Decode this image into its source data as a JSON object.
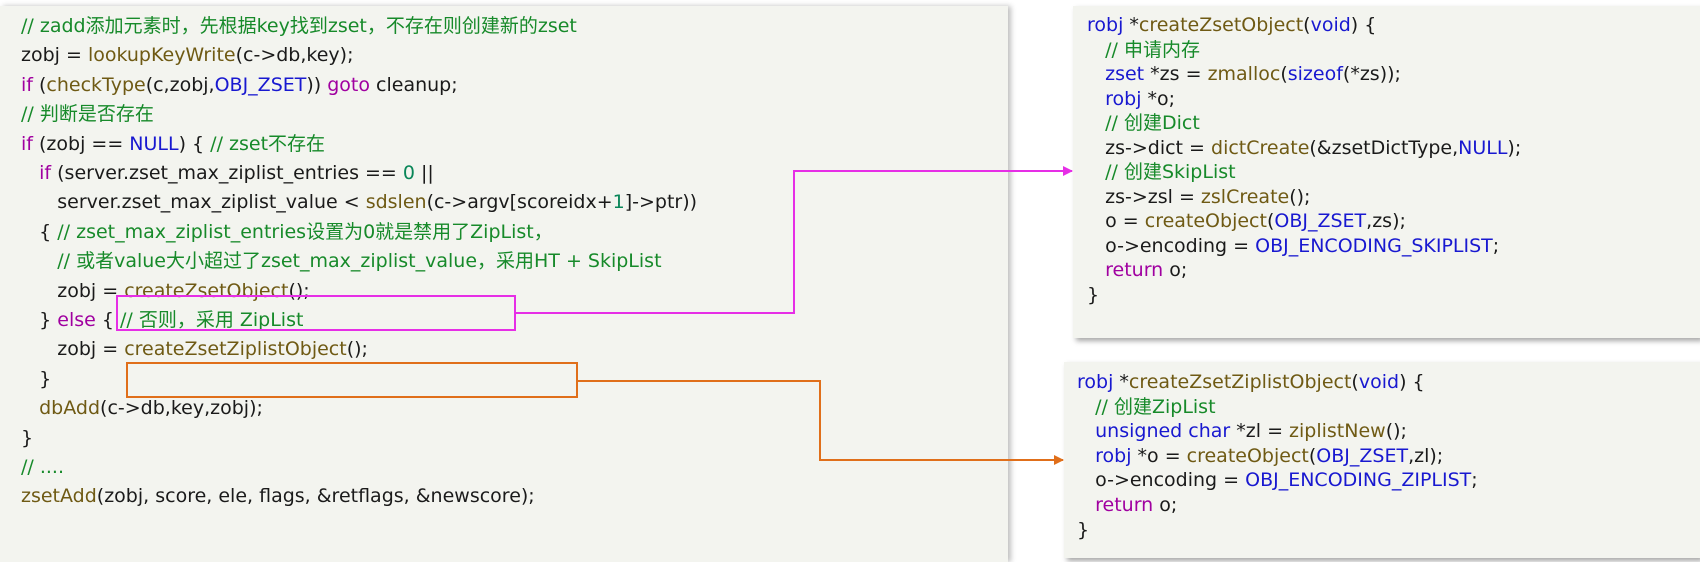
{
  "colors": {
    "keyword": "#a000a0",
    "function": "#6f5a14",
    "constant": "#1818d0",
    "comment": "#178a2a",
    "number": "#098658",
    "plain": "#1a1a1a",
    "highlight_magenta": "#e62ee6",
    "highlight_orange": "#e06f1a",
    "panel_background": "#f3f4ef"
  },
  "main_code": [
    [
      [
        "cm",
        "// zadd添加元素时，先根据key找到zset，不存在则创建新的zset"
      ]
    ],
    [
      [
        "p",
        "zobj = "
      ],
      [
        "fn",
        "lookupKeyWrite"
      ],
      [
        "p",
        "(c->db,key);"
      ]
    ],
    [
      [
        "kw",
        "if"
      ],
      [
        "p",
        " ("
      ],
      [
        "fn",
        "checkType"
      ],
      [
        "p",
        "(c,zobj,"
      ],
      [
        "const",
        "OBJ_ZSET"
      ],
      [
        "p",
        ")) "
      ],
      [
        "kw",
        "goto"
      ],
      [
        "p",
        " cleanup;"
      ]
    ],
    [
      [
        "cm",
        "// 判断是否存在"
      ]
    ],
    [
      [
        "kw",
        "if"
      ],
      [
        "p",
        " (zobj == "
      ],
      [
        "const",
        "NULL"
      ],
      [
        "p",
        ") { "
      ],
      [
        "cm",
        "// zset不存在"
      ]
    ],
    [
      [
        "p",
        "   "
      ],
      [
        "kw",
        "if"
      ],
      [
        "p",
        " (server.zset_max_ziplist_entries == "
      ],
      [
        "num",
        "0"
      ],
      [
        "p",
        " ||"
      ]
    ],
    [
      [
        "p",
        "      server.zset_max_ziplist_value < "
      ],
      [
        "fn",
        "sdslen"
      ],
      [
        "p",
        "(c->argv[scoreidx+"
      ],
      [
        "num",
        "1"
      ],
      [
        "p",
        "]->ptr))"
      ]
    ],
    [
      [
        "p",
        "   { "
      ],
      [
        "cm",
        "// zset_max_ziplist_entries设置为0就是禁用了ZipList，"
      ]
    ],
    [
      [
        "p",
        "      "
      ],
      [
        "cm",
        "// 或者value大小超过了zset_max_ziplist_value，采用HT + SkipList"
      ]
    ],
    [
      [
        "p",
        "      zobj = "
      ],
      [
        "fn",
        "createZsetObject"
      ],
      [
        "p",
        "();"
      ]
    ],
    [
      [
        "p",
        "   } "
      ],
      [
        "kw",
        "else"
      ],
      [
        "p",
        " { "
      ],
      [
        "cm",
        "// 否则，采用 ZipList"
      ]
    ],
    [
      [
        "p",
        "      zobj = "
      ],
      [
        "fn",
        "createZsetZiplistObject"
      ],
      [
        "p",
        "();"
      ]
    ],
    [
      [
        "p",
        "   }"
      ]
    ],
    [
      [
        "p",
        "   "
      ],
      [
        "fn",
        "dbAdd"
      ],
      [
        "p",
        "(c->db,key,zobj);"
      ]
    ],
    [
      [
        "p",
        "}"
      ]
    ],
    [
      [
        "cm",
        "// ...."
      ]
    ],
    [
      [
        "fn",
        "zsetAdd"
      ],
      [
        "p",
        "(zobj, score, ele, flags, &retflags, &newscore);"
      ]
    ]
  ],
  "zset_code": [
    [
      [
        "const",
        "robj"
      ],
      [
        "p",
        " *"
      ],
      [
        "fn",
        "createZsetObject"
      ],
      [
        "p",
        "("
      ],
      [
        "const",
        "void"
      ],
      [
        "p",
        ") {"
      ]
    ],
    [
      [
        "p",
        "   "
      ],
      [
        "cm",
        "// 申请内存"
      ]
    ],
    [
      [
        "p",
        "   "
      ],
      [
        "const",
        "zset"
      ],
      [
        "p",
        " *zs = "
      ],
      [
        "fn",
        "zmalloc"
      ],
      [
        "p",
        "("
      ],
      [
        "const",
        "sizeof"
      ],
      [
        "p",
        "(*zs));"
      ]
    ],
    [
      [
        "p",
        "   "
      ],
      [
        "const",
        "robj"
      ],
      [
        "p",
        " *o;"
      ]
    ],
    [
      [
        "p",
        "   "
      ],
      [
        "cm",
        "// 创建Dict"
      ]
    ],
    [
      [
        "p",
        "   zs->dict = "
      ],
      [
        "fn",
        "dictCreate"
      ],
      [
        "p",
        "(&zsetDictType,"
      ],
      [
        "const",
        "NULL"
      ],
      [
        "p",
        ");"
      ]
    ],
    [
      [
        "p",
        "   "
      ],
      [
        "cm",
        "// 创建SkipList"
      ]
    ],
    [
      [
        "p",
        "   zs->zsl = "
      ],
      [
        "fn",
        "zslCreate"
      ],
      [
        "p",
        "();"
      ]
    ],
    [
      [
        "p",
        "   o = "
      ],
      [
        "fn",
        "createObject"
      ],
      [
        "p",
        "("
      ],
      [
        "const",
        "OBJ_ZSET"
      ],
      [
        "p",
        ",zs);"
      ]
    ],
    [
      [
        "p",
        "   o->encoding = "
      ],
      [
        "const",
        "OBJ_ENCODING_SKIPLIST"
      ],
      [
        "p",
        ";"
      ]
    ],
    [
      [
        "p",
        "   "
      ],
      [
        "kw",
        "return"
      ],
      [
        "p",
        " o;"
      ]
    ],
    [
      [
        "p",
        "}"
      ]
    ]
  ],
  "ziplist_code": [
    [
      [
        "const",
        "robj"
      ],
      [
        "p",
        " *"
      ],
      [
        "fn",
        "createZsetZiplistObject"
      ],
      [
        "p",
        "("
      ],
      [
        "const",
        "void"
      ],
      [
        "p",
        ") {"
      ]
    ],
    [
      [
        "p",
        "   "
      ],
      [
        "cm",
        "// 创建ZipList"
      ]
    ],
    [
      [
        "p",
        "   "
      ],
      [
        "const",
        "unsigned char"
      ],
      [
        "p",
        " *zl = "
      ],
      [
        "fn",
        "ziplistNew"
      ],
      [
        "p",
        "();"
      ]
    ],
    [
      [
        "p",
        "   "
      ],
      [
        "const",
        "robj"
      ],
      [
        "p",
        " *o = "
      ],
      [
        "fn",
        "createObject"
      ],
      [
        "p",
        "("
      ],
      [
        "const",
        "OBJ_ZSET"
      ],
      [
        "p",
        ",zl);"
      ]
    ],
    [
      [
        "p",
        "   o->encoding = "
      ],
      [
        "const",
        "OBJ_ENCODING_ZIPLIST"
      ],
      [
        "p",
        ";"
      ]
    ],
    [
      [
        "p",
        "   "
      ],
      [
        "kw",
        "return"
      ],
      [
        "p",
        " o;"
      ]
    ],
    [
      [
        "p",
        "}"
      ]
    ]
  ]
}
